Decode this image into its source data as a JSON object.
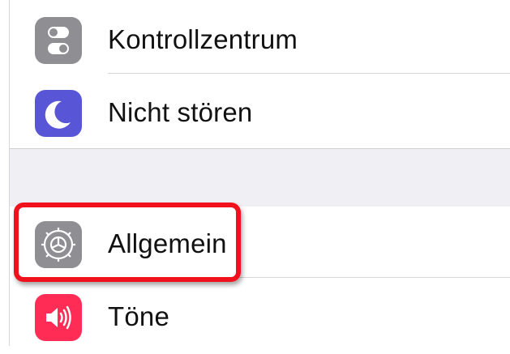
{
  "settings": {
    "items": [
      {
        "label": "Kontrollzentrum",
        "icon": "control-center-icon",
        "color": "#8e8e93"
      },
      {
        "label": "Nicht stören",
        "icon": "moon-icon",
        "color": "#5856d6"
      },
      {
        "label": "Allgemein",
        "icon": "gear-icon",
        "color": "#8e8e93",
        "highlighted": true
      },
      {
        "label": "Töne",
        "icon": "speaker-icon",
        "color": "#ff2d55"
      }
    ]
  },
  "colors": {
    "highlight_border": "#f0111c",
    "group_separator": "#efeff4"
  }
}
